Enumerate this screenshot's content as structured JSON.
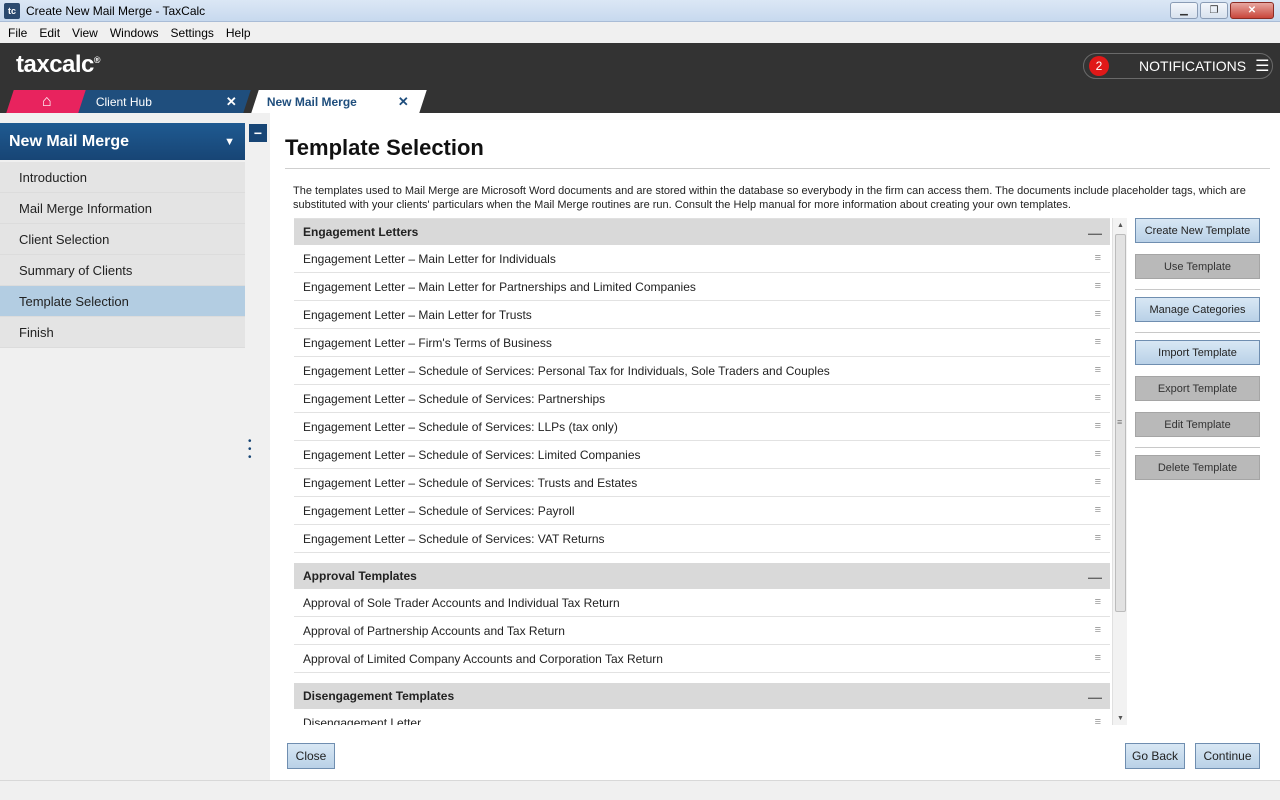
{
  "window": {
    "title": "Create New Mail Merge - TaxCalc",
    "icon_label": "tc",
    "controls": [
      "minimize-icon",
      "restore-icon",
      "close-icon"
    ]
  },
  "menu": [
    "File",
    "Edit",
    "View",
    "Windows",
    "Settings",
    "Help"
  ],
  "header": {
    "logo": "taxcalc",
    "logo_mark": "®",
    "notifications_count": "2",
    "notifications_label": "NOTIFICATIONS"
  },
  "tabs": [
    {
      "label": "",
      "icon": "home-icon"
    },
    {
      "label": "Client Hub",
      "close": "✕"
    },
    {
      "label": "New Mail Merge",
      "close": "✕"
    }
  ],
  "sidebar": {
    "title": "New Mail Merge",
    "items": [
      {
        "label": "Introduction"
      },
      {
        "label": "Mail Merge Information"
      },
      {
        "label": "Client Selection"
      },
      {
        "label": "Summary of Clients"
      },
      {
        "label": "Template Selection"
      },
      {
        "label": "Finish"
      }
    ],
    "active_index": 4
  },
  "main": {
    "title": "Template Selection",
    "intro": "The templates used to Mail Merge are Microsoft Word documents and are stored within the database so everybody in the firm can access them. The documents include placeholder tags, which are substituted with your clients' particulars when the Mail Merge routines are run. Consult the Help manual for more information about creating your own templates.",
    "categories": [
      {
        "name": "Engagement Letters",
        "templates": [
          "Engagement Letter – Main Letter for Individuals",
          "Engagement Letter – Main Letter for Partnerships and Limited Companies",
          "Engagement Letter – Main Letter for Trusts",
          "Engagement Letter – Firm's Terms of Business",
          "Engagement Letter – Schedule of Services: Personal Tax for Individuals, Sole Traders and Couples",
          "Engagement Letter – Schedule of Services: Partnerships",
          "Engagement Letter – Schedule of Services: LLPs (tax only)",
          "Engagement Letter – Schedule of Services: Limited Companies",
          "Engagement Letter – Schedule of Services: Trusts and Estates",
          "Engagement Letter – Schedule of Services: Payroll",
          "Engagement Letter – Schedule of Services: VAT Returns"
        ]
      },
      {
        "name": "Approval Templates",
        "templates": [
          "Approval of Sole Trader Accounts and Individual Tax Return",
          "Approval of Partnership Accounts and Tax Return",
          "Approval of Limited Company Accounts and Corporation Tax Return"
        ]
      },
      {
        "name": "Disengagement Templates",
        "templates": [
          "Disengagement Letter"
        ]
      }
    ],
    "actions": [
      {
        "label": "Create New Template",
        "enabled": true
      },
      {
        "label": "Use Template",
        "enabled": false
      },
      {
        "label": "Manage Categories",
        "enabled": true
      },
      {
        "label": "Import Template",
        "enabled": true
      },
      {
        "label": "Export Template",
        "enabled": false
      },
      {
        "label": "Edit Template",
        "enabled": false
      },
      {
        "label": "Delete Template",
        "enabled": false
      }
    ],
    "footer": {
      "close": "Close",
      "back": "Go Back",
      "continue": "Continue"
    }
  },
  "colors": {
    "header_bg": "#333333",
    "home_tab": "#e8235e",
    "sidebar_head": "#174575",
    "active_item": "#b3cde2",
    "notification_badge": "#e01818"
  }
}
